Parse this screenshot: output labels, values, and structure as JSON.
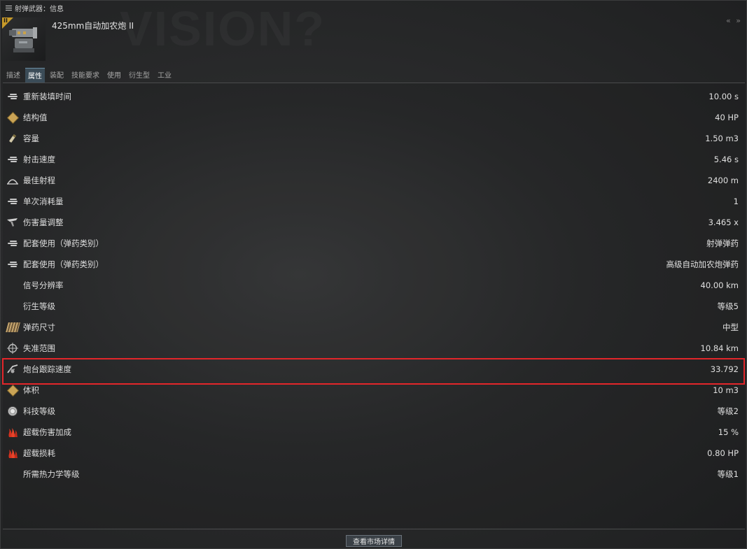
{
  "window": {
    "title": "射弹武器：信息",
    "collapse_icon": "double-chevron-icon",
    "collapse_glyph": "« »"
  },
  "item": {
    "name": "425mm自动加农炮 II",
    "tech_badge": "II"
  },
  "tabs": [
    {
      "label": "描述",
      "active": false
    },
    {
      "label": "属性",
      "active": true
    },
    {
      "label": "装配",
      "active": false
    },
    {
      "label": "技能要求",
      "active": false
    },
    {
      "label": "使用",
      "active": false
    },
    {
      "label": "衍生型",
      "active": false
    },
    {
      "label": "工业",
      "active": false
    }
  ],
  "attributes": [
    {
      "label": "重新装填时间",
      "value": "10.00 s",
      "icon": "speed-streak-icon"
    },
    {
      "label": "结构值",
      "value": "40 HP",
      "icon": "structure-box-icon"
    },
    {
      "label": "容量",
      "value": "1.50 m3",
      "icon": "capacity-icon"
    },
    {
      "label": "射击速度",
      "value": "5.46 s",
      "icon": "speed-streak-icon"
    },
    {
      "label": "最佳射程",
      "value": "2400 m",
      "icon": "range-icon"
    },
    {
      "label": "单次消耗量",
      "value": "1",
      "icon": "speed-streak-icon"
    },
    {
      "label": "伤害量调整",
      "value": "3.465 x",
      "icon": "damage-modifier-icon"
    },
    {
      "label": "配套使用（弹药类别）",
      "value": "射弹弹药",
      "icon": "speed-streak-icon"
    },
    {
      "label": "配套使用（弹药类别）",
      "value": "高级自动加农炮弹药",
      "icon": "speed-streak-icon"
    },
    {
      "label": "信号分辨率",
      "value": "40.00 km",
      "icon": ""
    },
    {
      "label": "衍生等级",
      "value": "等级5",
      "icon": ""
    },
    {
      "label": "弹药尺寸",
      "value": "中型",
      "icon": "ammo-size-icon"
    },
    {
      "label": "失准范围",
      "value": "10.84 km",
      "icon": "falloff-crosshair-icon"
    },
    {
      "label": "炮台跟踪速度",
      "value": "33.792",
      "icon": "tracking-speed-icon"
    },
    {
      "label": "体积",
      "value": "10 m3",
      "icon": "volume-box-icon"
    },
    {
      "label": "科技等级",
      "value": "等级2",
      "icon": "tech-level-icon"
    },
    {
      "label": "超载伤害加成",
      "value": "15 %",
      "icon": "overheat-flame-icon"
    },
    {
      "label": "超载损耗",
      "value": "0.80 HP",
      "icon": "overheat-flame-icon"
    },
    {
      "label": "所需热力学等级",
      "value": "等级1",
      "icon": ""
    }
  ],
  "highlighted_attribute": "炮台跟踪速度",
  "highlight_color": "#e3262a",
  "footer": {
    "market_button_label": "查看市场详情"
  }
}
